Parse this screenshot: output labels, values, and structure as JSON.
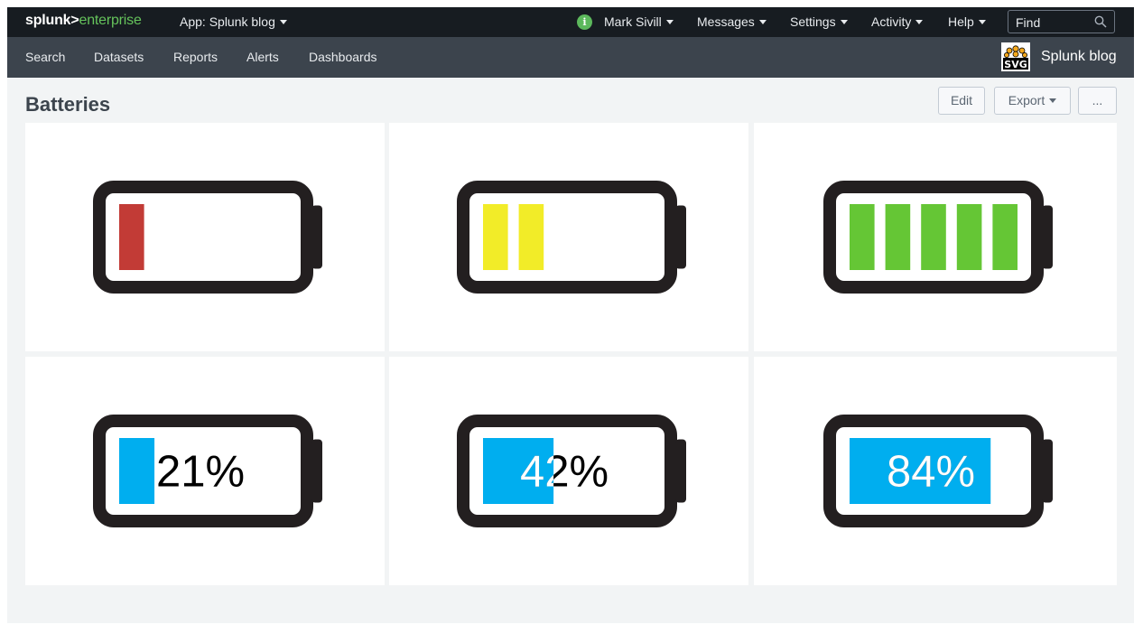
{
  "topbar": {
    "logo_main": "splunk>",
    "logo_product": "enterprise",
    "app_label": "App: Splunk blog",
    "user": "Mark Sivill",
    "messages": "Messages",
    "settings": "Settings",
    "activity": "Activity",
    "help": "Help",
    "find_placeholder": "Find"
  },
  "icons": {
    "info": "info-icon",
    "find": "search-icon",
    "app": "svg-app-icon"
  },
  "navbar": {
    "items": [
      "Search",
      "Datasets",
      "Reports",
      "Alerts",
      "Dashboards"
    ],
    "app_name": "Splunk blog",
    "app_icon_text": "SVG"
  },
  "dashboard": {
    "title": "Batteries",
    "buttons": {
      "edit": "Edit",
      "export": "Export",
      "more": "..."
    }
  },
  "colors": {
    "red": "#c23b36",
    "yellow": "#f2ec28",
    "green": "#65c635",
    "blue": "#00aeef",
    "battery_outline": "#231f20"
  },
  "batteries": [
    {
      "style": "segments",
      "segments_filled": 1,
      "segments_total": 5,
      "color": "#c23b36"
    },
    {
      "style": "segments",
      "segments_filled": 2,
      "segments_total": 5,
      "color": "#f2ec28"
    },
    {
      "style": "segments",
      "segments_filled": 5,
      "segments_total": 5,
      "color": "#65c635"
    },
    {
      "style": "percent",
      "percent": 21,
      "label": "21%",
      "color": "#00aeef"
    },
    {
      "style": "percent",
      "percent": 42,
      "label": "42%",
      "color": "#00aeef"
    },
    {
      "style": "percent",
      "percent": 84,
      "label": "84%",
      "color": "#00aeef"
    }
  ]
}
